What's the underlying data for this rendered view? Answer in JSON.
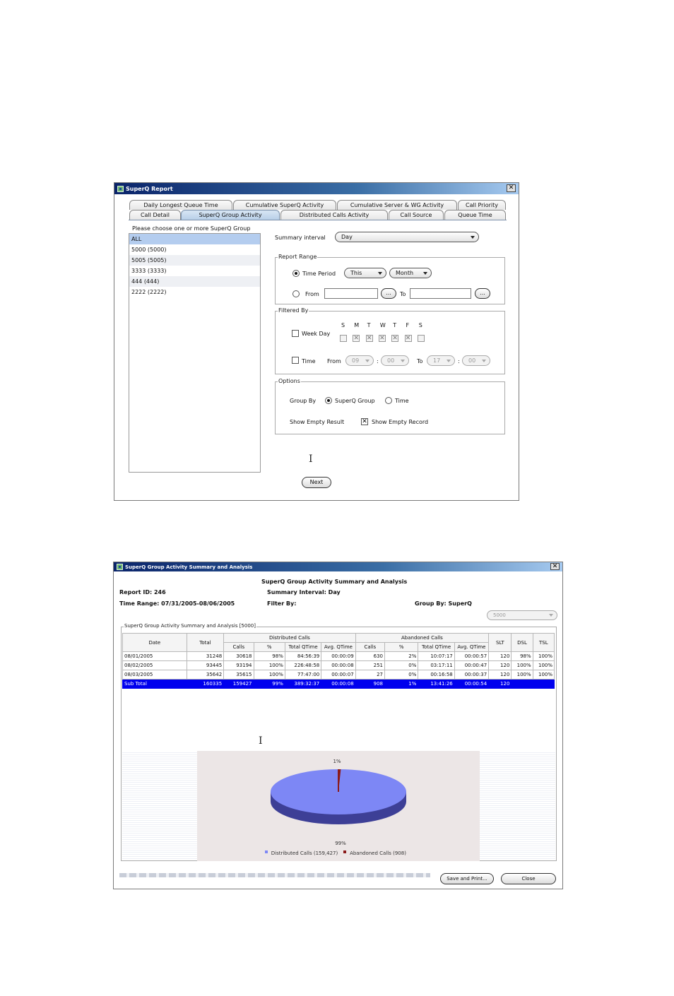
{
  "window1": {
    "title": "SuperQ Report",
    "tabs_row1": [
      "Daily Longest Queue Time",
      "Cumulative SuperQ Activity",
      "Cumulative Server & WG Activity",
      "Call Priority"
    ],
    "tabs_row2": [
      "Call Detail",
      "SuperQ Group Activity",
      "Distributed Calls Activity",
      "Call Source",
      "Queue Time"
    ],
    "selected_tab": "SuperQ Group Activity",
    "group_list_title": "Please choose one or more SuperQ Group",
    "groups": [
      "ALL",
      "5000 (5000)",
      "5005 (5005)",
      "3333 (3333)",
      "444 (444)",
      "2222 (2222)"
    ],
    "selected_group": "ALL",
    "summary_interval_label": "Summary interval",
    "summary_interval_value": "Day",
    "report_range": {
      "title": "Report Range",
      "time_period_label": "Time Period",
      "period_value": "This",
      "unit_value": "Month",
      "from_label": "From",
      "to_label": "To",
      "browse": "..."
    },
    "filtered_by": {
      "title": "Filtered By",
      "weekday_label": "Week Day",
      "days": [
        "S",
        "M",
        "T",
        "W",
        "T",
        "F",
        "S"
      ],
      "day_checked": [
        false,
        true,
        true,
        true,
        true,
        true,
        false
      ],
      "time_label": "Time",
      "from_label": "From",
      "to_label": "To",
      "from_hour": "09",
      "from_min": "00",
      "to_hour": "17",
      "to_min": "00",
      "colon": ":"
    },
    "options": {
      "title": "Options",
      "group_by_label": "Group By",
      "group_by_superq": "SuperQ Group",
      "group_by_time": "Time",
      "show_empty_label": "Show Empty Result",
      "show_empty_record": "Show Empty Record"
    },
    "next_button": "Next"
  },
  "window2": {
    "title": "SuperQ Group Activity Summary and Analysis",
    "heading": "SuperQ Group Activity Summary and Analysis",
    "report_id": "Report ID: 246",
    "summary_interval": "Summary Interval: Day",
    "time_range": "Time Range: 07/31/2005-08/06/2005",
    "filter_by": "Filter By:",
    "group_by": "Group By: SuperQ",
    "group_select": "5000",
    "panel_title": "SuperQ Group Activity Summary and Analysis [5000]",
    "table": {
      "group_headers": {
        "distributed": "Distributed Calls",
        "abandoned": "Abandoned Calls"
      },
      "headers": {
        "date": "Date",
        "total": "Total",
        "calls": "Calls",
        "pct": "%",
        "total_qtime": "Total QTime",
        "avg_qtime": "Avg. QTime",
        "slt": "SLT",
        "dsl": "DSL",
        "tsl": "TSL"
      },
      "rows": [
        [
          "08/01/2005",
          "31248",
          "30618",
          "98%",
          "84:56:39",
          "00:00:09",
          "630",
          "2%",
          "10:07:17",
          "00:00:57",
          "120",
          "98%",
          "100%"
        ],
        [
          "08/02/2005",
          "93445",
          "93194",
          "100%",
          "226:48:58",
          "00:00:08",
          "251",
          "0%",
          "03:17:11",
          "00:00:47",
          "120",
          "100%",
          "100%"
        ],
        [
          "08/03/2005",
          "35642",
          "35615",
          "100%",
          "77:47:00",
          "00:00:07",
          "27",
          "0%",
          "00:16:58",
          "00:00:37",
          "120",
          "100%",
          "100%"
        ]
      ],
      "subtotal": [
        "Sub Total",
        "160335",
        "159427",
        "99%",
        "389:32:37",
        "00:00:08",
        "908",
        "1%",
        "13:41:26",
        "00:00:54",
        "120",
        "",
        ""
      ]
    },
    "chart_data": {
      "type": "pie",
      "categories": [
        "Distributed Calls (159,427)",
        "Abandoned Calls (908)"
      ],
      "values": [
        159427,
        908
      ],
      "slice_labels": [
        "99%",
        "1%"
      ],
      "colors": [
        "#7d87f5",
        "#8b1a1a"
      ],
      "legend_position": "bottom"
    },
    "save_button": "Save and Print...",
    "close_button": "Close"
  }
}
